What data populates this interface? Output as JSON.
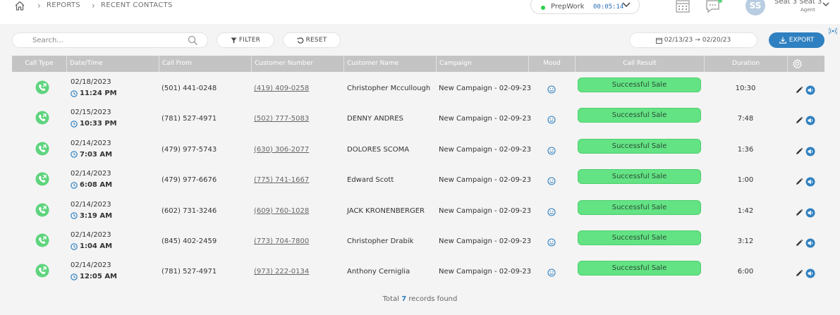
{
  "breadcrumb": {
    "items": [
      "REPORTS",
      "RECENT CONTACTS"
    ]
  },
  "status": {
    "label": "PrepWork",
    "timer": "00:05:14",
    "dot_color": "#2fcf4d"
  },
  "user": {
    "initials": "SS",
    "name": "Seat 3 Seat 3",
    "role": "Agent"
  },
  "toolbar": {
    "search_placeholder": "Search...",
    "filter_label": "FILTER",
    "reset_label": "RESET",
    "date_from": "02/13/23",
    "date_arrow": "→",
    "date_to": "02/20/23",
    "export_label": "EXPORT",
    "accent_color": "#2f80c0"
  },
  "table": {
    "columns": [
      "Call Type",
      "Date/Time",
      "Call From",
      "Customer Number",
      "Customer Name",
      "Campaign",
      "Mood",
      "Call Result",
      "Duration"
    ],
    "rows": [
      {
        "date": "02/18/2023",
        "time": "11:24 PM",
        "call_from": "(501) 441-0248",
        "customer_number": "(419) 409-0258",
        "customer_name": "Christopher Mccullough",
        "campaign": "New Campaign - 02-09-23",
        "result": "Successful Sale",
        "duration": "10:30"
      },
      {
        "date": "02/15/2023",
        "time": "10:33 PM",
        "call_from": "(781) 527-4971",
        "customer_number": "(502) 777-5083",
        "customer_name": "DENNY ANDRES",
        "campaign": "New Campaign - 02-09-23",
        "result": "Successful Sale",
        "duration": "7:48"
      },
      {
        "date": "02/14/2023",
        "time": "7:03 AM",
        "call_from": "(479) 977-5743",
        "customer_number": "(630) 306-2077",
        "customer_name": "DOLORES SCOMA",
        "campaign": "New Campaign - 02-09-23",
        "result": "Successful Sale",
        "duration": "1:36"
      },
      {
        "date": "02/14/2023",
        "time": "6:08 AM",
        "call_from": "(479) 977-6676",
        "customer_number": "(775) 741-1667",
        "customer_name": "Edward Scott",
        "campaign": "New Campaign - 02-09-23",
        "result": "Successful Sale",
        "duration": "1:00"
      },
      {
        "date": "02/14/2023",
        "time": "3:19 AM",
        "call_from": "(602) 731-3246",
        "customer_number": "(609) 760-1028",
        "customer_name": "JACK KRONENBERGER",
        "campaign": "New Campaign - 02-09-23",
        "result": "Successful Sale",
        "duration": "1:42"
      },
      {
        "date": "02/14/2023",
        "time": "1:04 AM",
        "call_from": "(845) 402-2459",
        "customer_number": "(773) 704-7800",
        "customer_name": "Christopher Drabik",
        "campaign": "New Campaign - 02-09-23",
        "result": "Successful Sale",
        "duration": "3:12"
      },
      {
        "date": "02/14/2023",
        "time": "12:05 AM",
        "call_from": "(781) 527-4971",
        "customer_number": "(973) 222-0134",
        "customer_name": "Anthony Cerniglia",
        "campaign": "New Campaign - 02-09-23",
        "result": "Successful Sale",
        "duration": "6:00"
      }
    ],
    "result_color": "#63e384",
    "header_color": "#c4c4c4"
  },
  "footer": {
    "prefix": "Total",
    "count": "7",
    "suffix": "records found"
  },
  "icons": [
    "home-icon",
    "chevron-right-icon",
    "chevron-down-icon",
    "calendar-icon",
    "chat-icon",
    "search-icon",
    "filter-icon",
    "reset-icon",
    "calendar-icon",
    "download-icon",
    "signal-icon",
    "settings-icon",
    "outbound-call-icon",
    "clock-icon",
    "smiley-icon",
    "edit-icon",
    "play-audio-icon"
  ]
}
